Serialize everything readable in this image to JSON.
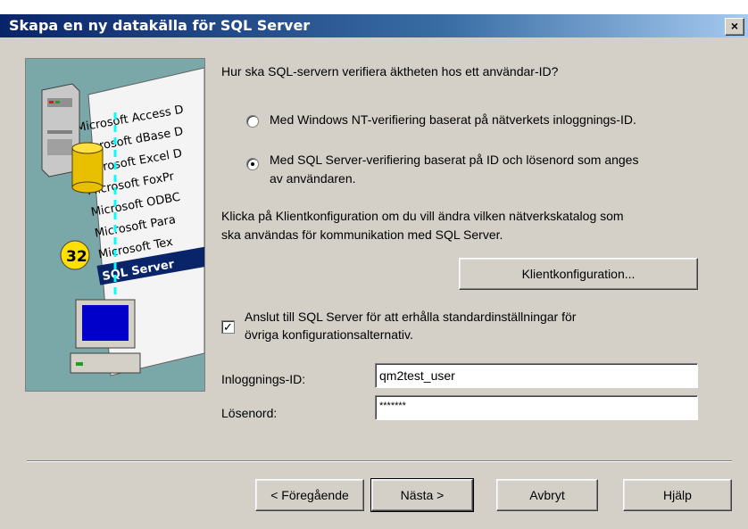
{
  "window": {
    "title": "Skapa en ny datakälla för SQL Server",
    "close_label": "×"
  },
  "sidebar_art": {
    "driver_list": [
      "Microsoft Access D",
      "Microsoft dBase D",
      "Microsoft Excel D",
      "Microsoft FoxPr",
      "Microsoft ODBC",
      "Microsoft Para",
      "Microsoft Tex",
      "SQL Server"
    ],
    "badge": "32"
  },
  "question": "Hur ska SQL-servern verifiera äktheten hos ett användar-ID?",
  "auth_options": [
    {
      "label": "Med Windows NT-verifiering baserat på nätverkets inloggnings-ID.",
      "selected": false
    },
    {
      "label_line1": "Med SQL Server-verifiering baserat på ID och lösenord som anges",
      "label_line2": "av användaren.",
      "selected": true
    }
  ],
  "client_info": {
    "line1": "Klicka på Klientkonfiguration om du vill ändra vilken nätverkskatalog som",
    "line2": "ska användas för kommunikation med SQL Server."
  },
  "client_config_button": "Klientkonfiguration...",
  "connect_checkbox": {
    "checked": true,
    "check_mark": "✓",
    "line1": "Anslut till SQL Server för att erhålla standardinställningar för",
    "line2": "övriga konfigurationsalternativ."
  },
  "login": {
    "label": "Inloggnings-ID:",
    "value": "qm2test_user"
  },
  "password": {
    "label": "Lösenord:",
    "value": "*******"
  },
  "buttons": {
    "back": "< Föregående",
    "next": "Nästa >",
    "cancel": "Avbryt",
    "help": "Hjälp"
  }
}
